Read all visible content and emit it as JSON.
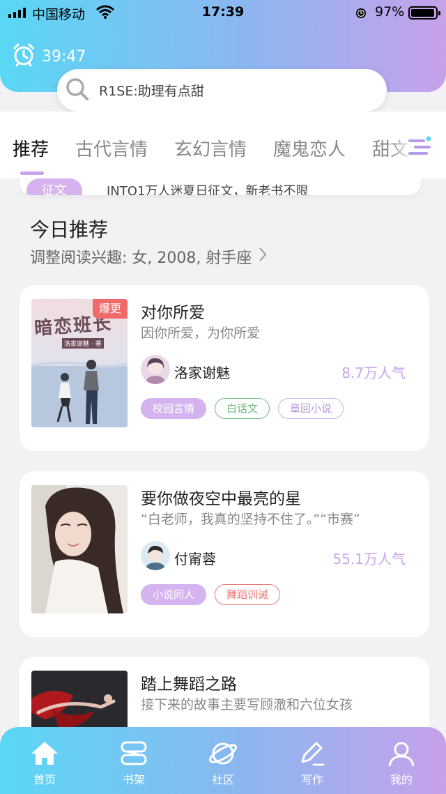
{
  "status_bar": {
    "carrier": "中国移动",
    "time": "17:39",
    "battery": "97%",
    "battery_level": 0.97
  },
  "timer": {
    "value": "39:47",
    "icon": "alarm-clock-icon"
  },
  "search": {
    "placeholder": "R1SE:助理有点甜",
    "icon": "search-icon"
  },
  "tabs": [
    "推荐",
    "古代言情",
    "玄幻言情",
    "魔鬼恋人",
    "甜文"
  ],
  "active_tab": "推荐",
  "notice": {
    "badge": "征文",
    "text": "INTO1万人迷夏日征文，新老书不限"
  },
  "section": {
    "title": "今日推荐",
    "subtitle": "调整阅读兴趣: 女, 2008, 射手座"
  },
  "books": [
    {
      "title": "对你所爱",
      "desc": "因你所爱，为你所爱",
      "author": "洛家谢魅",
      "popularity": "8.7万人气",
      "badge": "爆更",
      "cover_title": "暗恋班长",
      "cover_author": "洛家谢魅 · 著",
      "tags": [
        "校园言情",
        "白话文",
        "章回小说"
      ]
    },
    {
      "title": "要你做夜空中最亮的星",
      "desc": "“白老师，我真的坚持不住了。”“市赛”",
      "author": "付甯蓉",
      "popularity": "55.1万人气",
      "tags": [
        "小说同人",
        "舞蹈训诫"
      ]
    },
    {
      "title": "踏上舞蹈之路",
      "desc": "接下来的故事主要写顾澈和六位女孩"
    }
  ],
  "nav": [
    {
      "label": "首页",
      "icon": "home-icon"
    },
    {
      "label": "书架",
      "icon": "bookshelf-icon"
    },
    {
      "label": "社区",
      "icon": "planet-icon"
    },
    {
      "label": "写作",
      "icon": "pen-icon"
    },
    {
      "label": "我的",
      "icon": "profile-icon"
    }
  ],
  "colors": {
    "accent": "#c9a5ec",
    "gradient_start": "#5ad7f5",
    "gradient_end": "#c7a1ea",
    "hot": "#f06a6a"
  }
}
